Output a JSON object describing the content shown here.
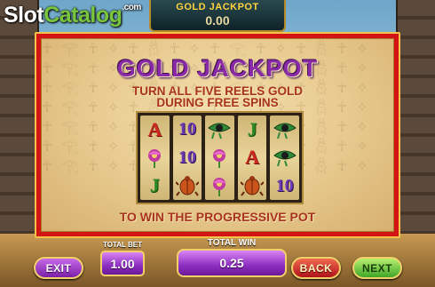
{
  "watermark": {
    "part1": "Slot",
    "part2": "Catalog",
    "suffix": ".com"
  },
  "jackpot_meter": {
    "title": "GOLD JACKPOT",
    "value": "0.00"
  },
  "panel": {
    "title": "GOLD JACKPOT",
    "subtitle_line1": "TURN ALL FIVE REELS GOLD",
    "subtitle_line2": "DURING FREE SPINS",
    "footer": "TO WIN THE PROGRESSIVE POT"
  },
  "reels": [
    [
      "A",
      "lotus",
      "J"
    ],
    [
      "10",
      "10",
      "scarab"
    ],
    [
      "eye",
      "lotus",
      "lotus"
    ],
    [
      "J",
      "A",
      "scarab"
    ],
    [
      "eye",
      "eye",
      "10"
    ]
  ],
  "bottom_bar": {
    "exit_label": "EXIT",
    "total_bet_label": "TOTAL BET",
    "total_bet_value": "1.00",
    "total_win_label": "TOTAL WIN",
    "total_win_value": "0.25",
    "back_label": "BACK",
    "next_label": "NEXT"
  },
  "colors": {
    "panel_border": "#d21414",
    "title_purple": "#8a2aa8",
    "text_red": "#a8331f",
    "gold": "#f1d06a"
  }
}
